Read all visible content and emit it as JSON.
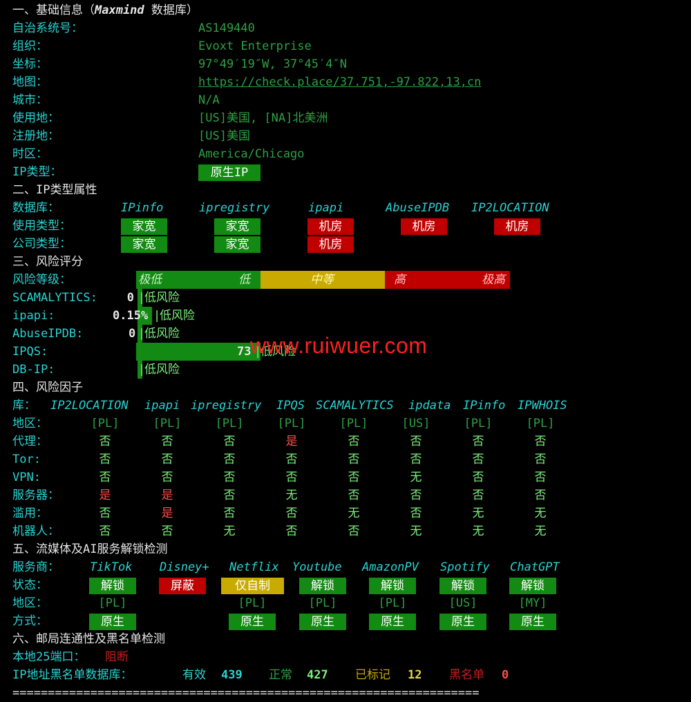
{
  "s1": {
    "title": "一、基础信息（",
    "title_db": "Maxmind",
    "title_tail": " 数据库）",
    "asn_label": "自治系统号：",
    "asn": "AS149440",
    "org_label": "组织：",
    "org": "Evoxt Enterprise",
    "coord_label": "坐标：",
    "coord": "97°49′19″W, 37°45′4″N",
    "map_label": "地图：",
    "map": "https://check.place/37.751,-97.822,13,cn",
    "city_label": "城市：",
    "city": "N/A",
    "use_label": "使用地：",
    "use": "[US]美国, [NA]北美洲",
    "reg_label": "注册地：",
    "reg": "[US]美国",
    "tz_label": "时区：",
    "tz": "America/Chicago",
    "iptype_label": "IP类型：",
    "iptype": "原生IP"
  },
  "s2": {
    "title": "二、IP类型属性",
    "db_label": "数据库：",
    "dbs": [
      "IPinfo",
      "ipregistry",
      "ipapi",
      "AbuseIPDB",
      "IP2LOCATION"
    ],
    "usage_label": "使用类型：",
    "usage": [
      "家宽",
      "家宽",
      "机房",
      "机房",
      "机房"
    ],
    "company_label": "公司类型：",
    "company": [
      "家宽",
      "家宽",
      "机房"
    ]
  },
  "s3": {
    "title": "三、风险评分",
    "level_label": "风险等级：",
    "bar": {
      "very_low": "极低",
      "low": "低",
      "medium": "中等",
      "high": "高",
      "very_high": "极高"
    },
    "scores": [
      {
        "label": "SCAMALYTICS:",
        "value": "0",
        "text": "低风险",
        "level": 0
      },
      {
        "label": "ipapi:",
        "value": "0.15%",
        "text": "低风险",
        "level": 0.15
      },
      {
        "label": "AbuseIPDB:",
        "value": "0",
        "text": "低风险",
        "level": 0
      },
      {
        "label": "IPQS:",
        "value": "73",
        "text": "低风险",
        "level": 73
      },
      {
        "label": "DB-IP:",
        "value": "",
        "text": "低风险",
        "level": 0
      }
    ]
  },
  "s4": {
    "title": "四、风险因子",
    "lib_label": "库：",
    "libs": [
      "IP2LOCATION",
      "ipapi",
      "ipregistry",
      "IPQS",
      "SCAMALYTICS",
      "ipdata",
      "IPinfo",
      "IPWHOIS"
    ],
    "region_label": "地区：",
    "regions": [
      "[PL]",
      "[PL]",
      "[PL]",
      "[PL]",
      "[PL]",
      "[US]",
      "[PL]",
      "[PL]"
    ],
    "rows": [
      {
        "label": "代理：",
        "values": [
          "否",
          "否",
          "否",
          "是",
          "否",
          "否",
          "否",
          "否"
        ]
      },
      {
        "label": "Tor:",
        "values": [
          "否",
          "否",
          "否",
          "否",
          "否",
          "否",
          "否",
          "否"
        ]
      },
      {
        "label": "VPN:",
        "values": [
          "否",
          "否",
          "否",
          "否",
          "否",
          "无",
          "否",
          "否"
        ]
      },
      {
        "label": "服务器：",
        "values": [
          "是",
          "是",
          "否",
          "无",
          "否",
          "否",
          "否",
          "否"
        ]
      },
      {
        "label": "滥用：",
        "values": [
          "否",
          "是",
          "否",
          "否",
          "无",
          "否",
          "无",
          "无"
        ]
      },
      {
        "label": "机器人：",
        "values": [
          "否",
          "否",
          "无",
          "否",
          "否",
          "无",
          "无",
          "无"
        ]
      }
    ]
  },
  "s5": {
    "title": "五、流媒体及AI服务解锁检测",
    "provider_label": "服务商：",
    "providers": [
      "TikTok",
      "Disney+",
      "Netflix",
      "Youtube",
      "AmazonPV",
      "Spotify",
      "ChatGPT"
    ],
    "status_label": "状态：",
    "status": [
      "解锁",
      "屏蔽",
      "仅自制",
      "解锁",
      "解锁",
      "解锁",
      "解锁"
    ],
    "region_label": "地区：",
    "regions": [
      "[PL]",
      "",
      "[PL]",
      "[PL]",
      "[PL]",
      "[US]",
      "[MY]"
    ],
    "method_label": "方式：",
    "methods": [
      "原生",
      "",
      "原生",
      "原生",
      "原生",
      "原生",
      "原生"
    ]
  },
  "s6": {
    "title": "六、邮局连通性及黑名单检测",
    "port_label": "本地25端口：",
    "port": "阻断",
    "bl_label": "IP地址黑名单数据库：",
    "valid_label": "有效",
    "valid": "439",
    "normal_label": "正常",
    "normal": "427",
    "marked_label": "已标记",
    "marked": "12",
    "black_label": "黑名单",
    "black": "0"
  },
  "footer": "==================================================================",
  "watermark": "www.ruiwuer.com",
  "colors": {
    "cyan": "#2bd2d2",
    "green": "#138a13",
    "red": "#c00000",
    "yellow": "#c8aa00"
  }
}
